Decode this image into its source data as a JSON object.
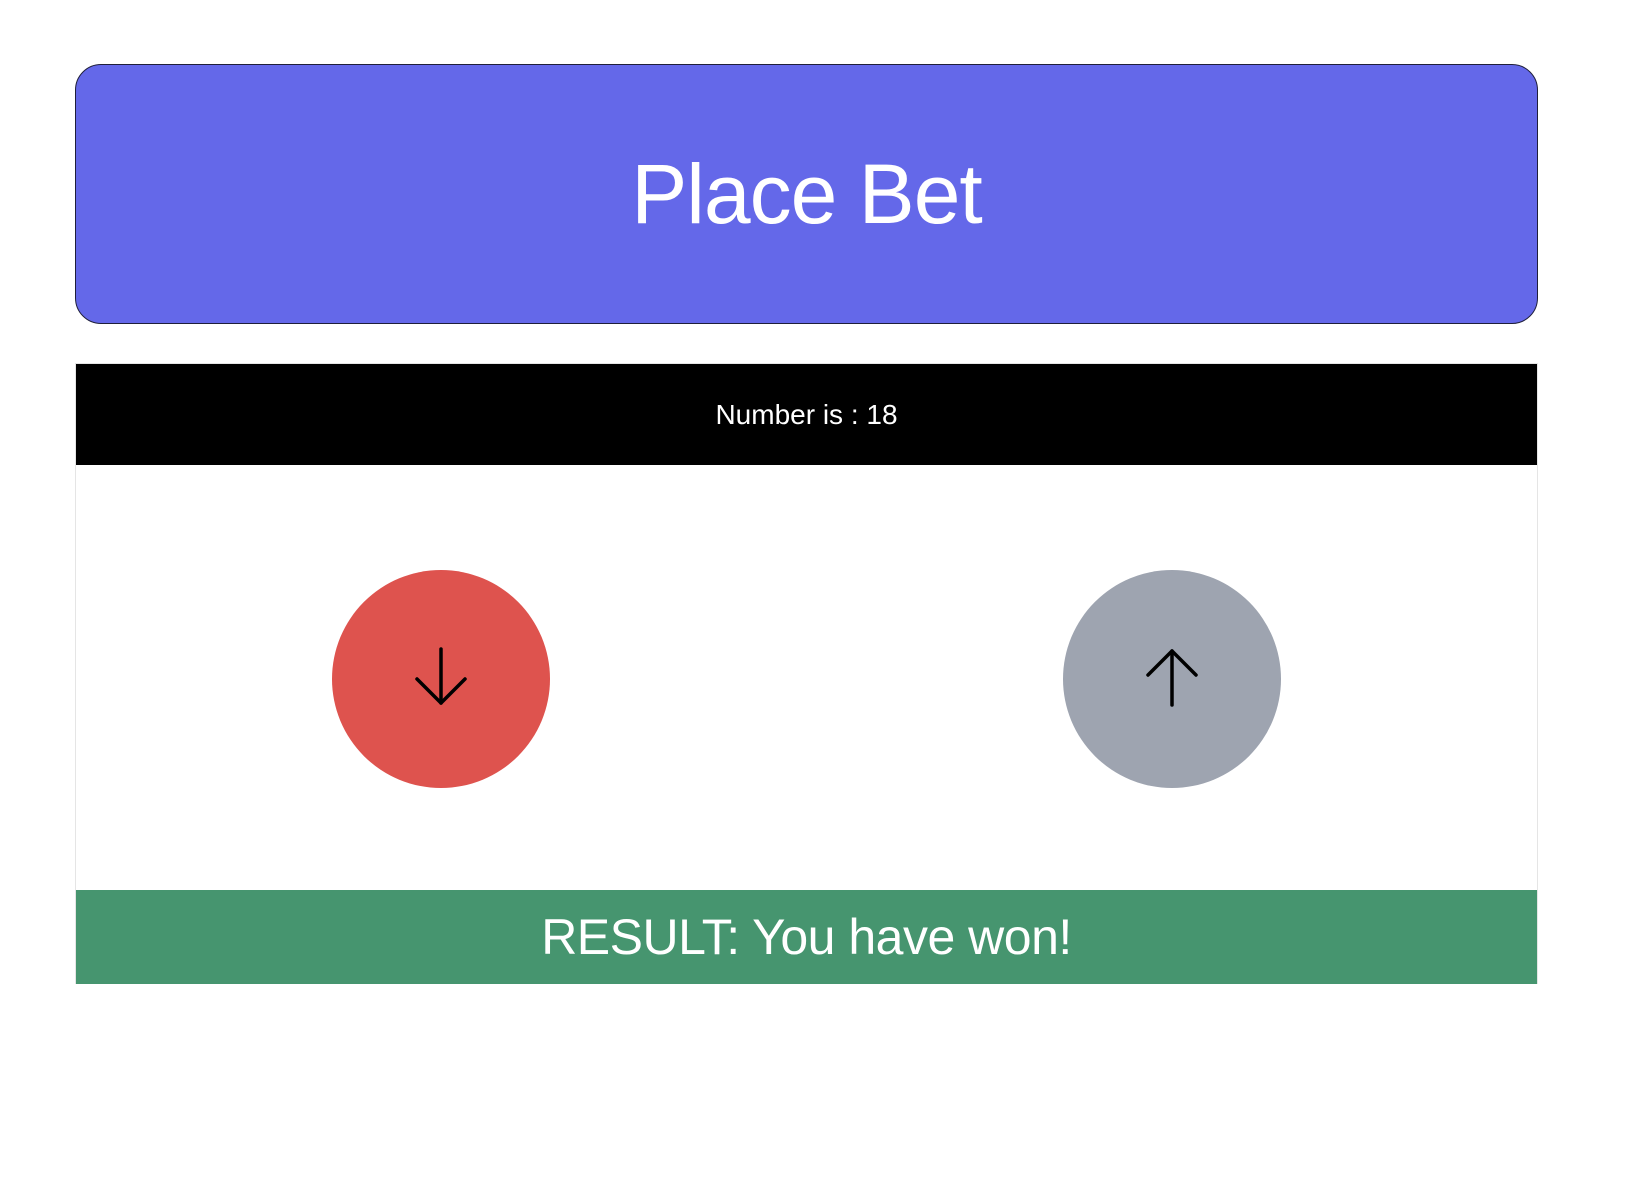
{
  "place_bet": {
    "label": "Place Bet",
    "color": "#6468e9"
  },
  "number_bar": {
    "text": "Number is : 18",
    "color": "#000000"
  },
  "controls": {
    "down": {
      "icon": "arrow-down-icon",
      "color": "#de534e"
    },
    "up": {
      "icon": "arrow-up-icon",
      "color": "#9ea4b0"
    }
  },
  "result": {
    "text": "RESULT: You have won!",
    "color": "#46956f"
  }
}
